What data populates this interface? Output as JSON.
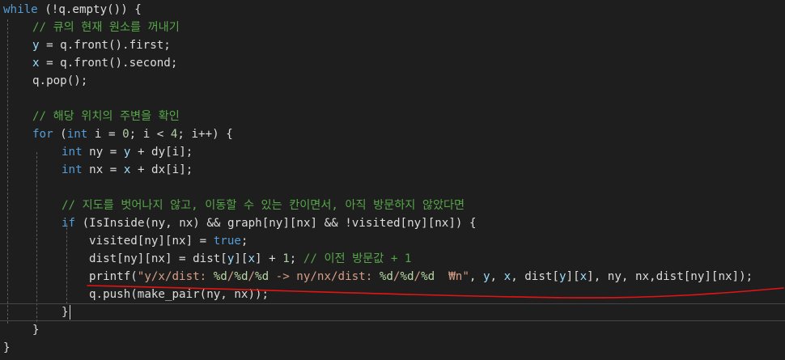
{
  "theme": {
    "background": "#1e1e1e",
    "keyword": "#569cd6",
    "comment": "#57a64a",
    "variable": "#9cdcfe",
    "text": "#dcdcdc",
    "string": "#d69d85",
    "format": "#b8d7a3",
    "number": "#b5cea8",
    "underline": "#e51414"
  },
  "code_lines": [
    [
      [
        "kw",
        "while"
      ],
      [
        "tx",
        " (!q.empty()) {"
      ]
    ],
    [
      [
        "cm",
        "// 큐의 현재 원소를 꺼내기"
      ]
    ],
    [
      [
        "vr",
        "y"
      ],
      [
        "tx",
        " = q.front().first;"
      ]
    ],
    [
      [
        "vr",
        "x"
      ],
      [
        "tx",
        " = q.front().second;"
      ]
    ],
    [
      [
        "tx",
        "q.pop();"
      ]
    ],
    [],
    [
      [
        "cm",
        "// 해당 위치의 주변을 확인"
      ]
    ],
    [
      [
        "kw",
        "for"
      ],
      [
        "tx",
        " ("
      ],
      [
        "kw",
        "int"
      ],
      [
        "tx",
        " i = "
      ],
      [
        "nm",
        "0"
      ],
      [
        "tx",
        "; i < "
      ],
      [
        "nm",
        "4"
      ],
      [
        "tx",
        "; i++) {"
      ]
    ],
    [
      [
        "kw",
        "int"
      ],
      [
        "tx",
        " ny = "
      ],
      [
        "vr",
        "y"
      ],
      [
        "tx",
        " + dy[i];"
      ]
    ],
    [
      [
        "kw",
        "int"
      ],
      [
        "tx",
        " nx = "
      ],
      [
        "vr",
        "x"
      ],
      [
        "tx",
        " + dx[i];"
      ]
    ],
    [],
    [
      [
        "cm",
        "// 지도를 벗어나지 않고, 이동할 수 있는 칸이면서, 아직 방문하지 않았다면"
      ]
    ],
    [
      [
        "kw",
        "if"
      ],
      [
        "tx",
        " (IsInside(ny, nx) && graph[ny][nx] && !visited[ny][nx]) {"
      ]
    ],
    [
      [
        "tx",
        "visited[ny][nx] = "
      ],
      [
        "kw",
        "true"
      ],
      [
        "tx",
        ";"
      ]
    ],
    [
      [
        "tx",
        "dist[ny][nx] = dist["
      ],
      [
        "vr",
        "y"
      ],
      [
        "tx",
        "]["
      ],
      [
        "vr",
        "x"
      ],
      [
        "tx",
        "] + "
      ],
      [
        "nm",
        "1"
      ],
      [
        "tx",
        "; "
      ],
      [
        "cm",
        "// 이전 방문값 + 1"
      ]
    ],
    [
      [
        "tx",
        "printf("
      ],
      [
        "st",
        "\"y/x/dist: "
      ],
      [
        "fm",
        "%d"
      ],
      [
        "st",
        "/"
      ],
      [
        "fm",
        "%d"
      ],
      [
        "st",
        "/"
      ],
      [
        "fm",
        "%d"
      ],
      [
        "st",
        " -> ny/nx/dist: "
      ],
      [
        "fm",
        "%d"
      ],
      [
        "st",
        "/"
      ],
      [
        "fm",
        "%d"
      ],
      [
        "st",
        "/"
      ],
      [
        "fm",
        "%d"
      ],
      [
        "st",
        "  ₩n\""
      ],
      [
        "tx",
        ", "
      ],
      [
        "vr",
        "y"
      ],
      [
        "tx",
        ", "
      ],
      [
        "vr",
        "x"
      ],
      [
        "tx",
        ", dist["
      ],
      [
        "vr",
        "y"
      ],
      [
        "tx",
        "]["
      ],
      [
        "vr",
        "x"
      ],
      [
        "tx",
        "], ny, nx,dist[ny][nx]);"
      ]
    ],
    [
      [
        "tx",
        "q.push(make_pair(ny, nx));"
      ]
    ],
    [
      [
        "tx",
        "}"
      ]
    ],
    [
      [
        "tx",
        "}"
      ]
    ],
    [
      [
        "tx",
        "}"
      ]
    ]
  ]
}
